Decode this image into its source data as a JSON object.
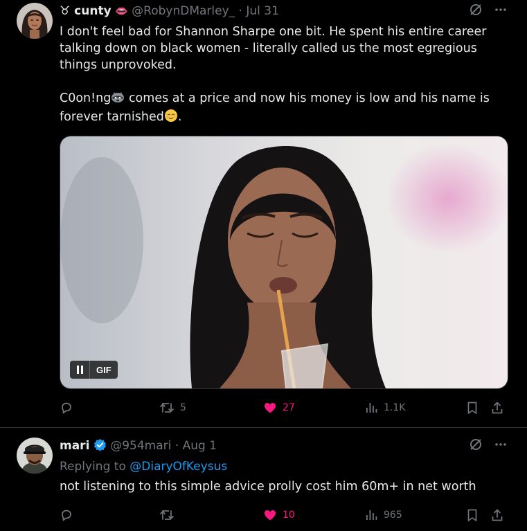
{
  "tweet1": {
    "display_name": "♉ cunty",
    "handle": "@RobynDMarley_",
    "separator": "·",
    "date": "Jul 31",
    "text_para1": "I don't feel bad for Shannon Sharpe one bit. He spent his entire career talking down on black women - literally called us the most egregious things unprovoked.",
    "text_para2_a": "C0on!ng",
    "text_para2_b": " comes at a price and now his money is low and his name is forever tarnished",
    "text_para2_c": ".",
    "gif_label": "GIF",
    "retweets": "5",
    "likes": "27",
    "views": "1.1K",
    "lips_emoji": "👄"
  },
  "tweet2": {
    "display_name": "mari",
    "handle": "@954mari",
    "separator": "·",
    "date": "Aug 1",
    "replying_prefix": "Replying to ",
    "replying_to": "@DiaryOfKeysus",
    "text": "not listening to this simple advice prolly cost him 60m+ in net worth",
    "likes": "10",
    "views": "965"
  },
  "colors": {
    "background": "#000000",
    "text": "#e7e9ea",
    "muted": "#71767b",
    "like": "#f91880",
    "link": "#1d9bf0",
    "divider": "#2f3336",
    "verified": "#1d9bf0"
  },
  "icons": [
    "grok-icon",
    "more-icon",
    "reply-icon",
    "retweet-icon",
    "like-icon-filled",
    "views-icon",
    "bookmark-icon",
    "share-icon",
    "verified-badge-icon",
    "raccoon-emoji",
    "relieved-emoji",
    "pause-icon"
  ]
}
